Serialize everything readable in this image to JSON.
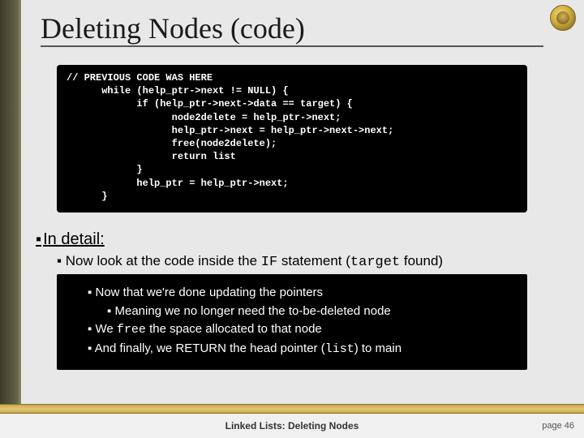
{
  "title": "Deleting Nodes (code)",
  "code": {
    "l1": "// PREVIOUS CODE WAS HERE",
    "l2": "      while (help_ptr->next != NULL) {",
    "l3": "            if (help_ptr->next->data == target) {",
    "l4": "                  node2delete = help_ptr->next;",
    "l5": "                  help_ptr->next = help_ptr->next->next;",
    "l6": "                  free(node2delete);",
    "l7": "                  return list",
    "l8": "            }",
    "l9": "            help_ptr = help_ptr->next;",
    "l10": "      }"
  },
  "detail_heading": "In detail:",
  "detail_line": {
    "a": "Now look at the code inside the ",
    "b": "IF",
    "c": " statement (",
    "d": "target",
    "e": " found)"
  },
  "bullets": {
    "b1": "Now that we're done updating the pointers",
    "b2": "Meaning we no longer need the to-be-deleted node",
    "b3a": "We ",
    "b3b": "free",
    "b3c": " the space allocated to that node",
    "b4a": "And finally, we RETURN the head pointer (",
    "b4b": "list",
    "b4c": ") to main"
  },
  "footer_title": "Linked Lists: Deleting Nodes",
  "page_label": "page 46",
  "bullet_char": "▪"
}
